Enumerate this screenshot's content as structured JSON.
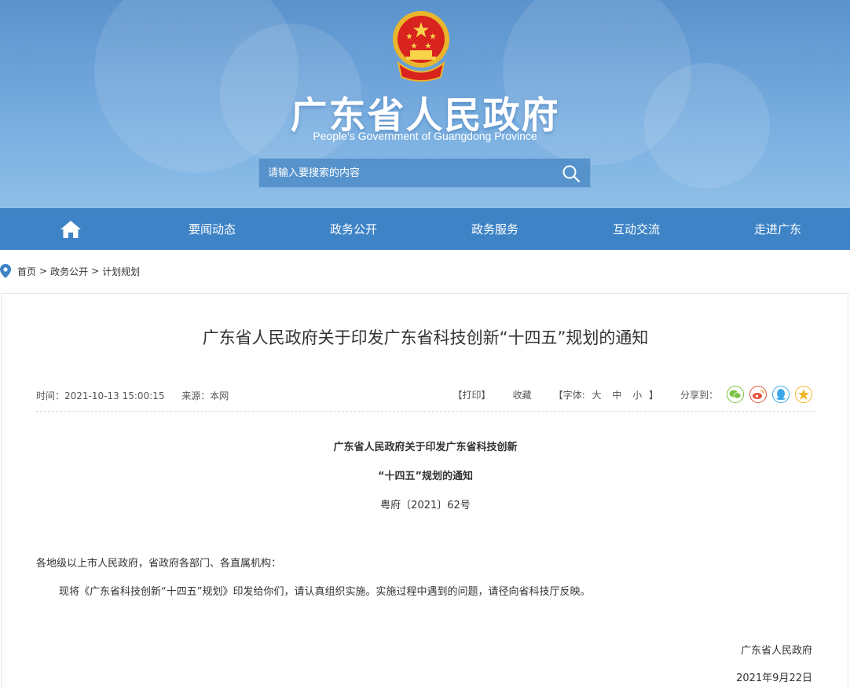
{
  "header": {
    "title": "广东省人民政府",
    "subtitle": "People’s Government of Guangdong Province",
    "search_placeholder": "请输入要搜索的内容"
  },
  "nav": {
    "items": [
      {
        "label": "要闻动态"
      },
      {
        "label": "政务公开"
      },
      {
        "label": "政务服务"
      },
      {
        "label": "互动交流"
      },
      {
        "label": "走进广东"
      }
    ]
  },
  "breadcrumb": {
    "items": [
      "首页",
      "政务公开",
      "计划规划"
    ],
    "separator": ">"
  },
  "article": {
    "title": "广东省人民政府关于印发广东省科技创新“十四五”规划的通知",
    "time": "时间：2021-10-13 15:00:15",
    "source": "来源：本网",
    "print": "【打印】",
    "favorite": "收藏",
    "font_label": "【字体:",
    "font_large": "大",
    "font_medium": "中",
    "font_small": "小",
    "font_close": "】",
    "share_label": "分享到：",
    "doc_heading_1": "广东省人民政府关于印发广东省科技创新",
    "doc_heading_2": "“十四五”规划的通知",
    "doc_number": "粤府〔2021〕62号",
    "addressee": "各地级以上市人民政府，省政府各部门、各直属机构：",
    "body": "现将《广东省科技创新“十四五”规划》印发给你们，请认真组织实施。实施过程中遇到的问题，请径向省科技厅反映。",
    "signature_org": "广东省人民政府",
    "signature_date": "2021年9月22日"
  },
  "colors": {
    "nav_bg": "#3d83c6",
    "wechat": "#7ac143",
    "weibo": "#e5543f",
    "qq": "#3aa8e8",
    "qzone": "#f3b72e"
  }
}
